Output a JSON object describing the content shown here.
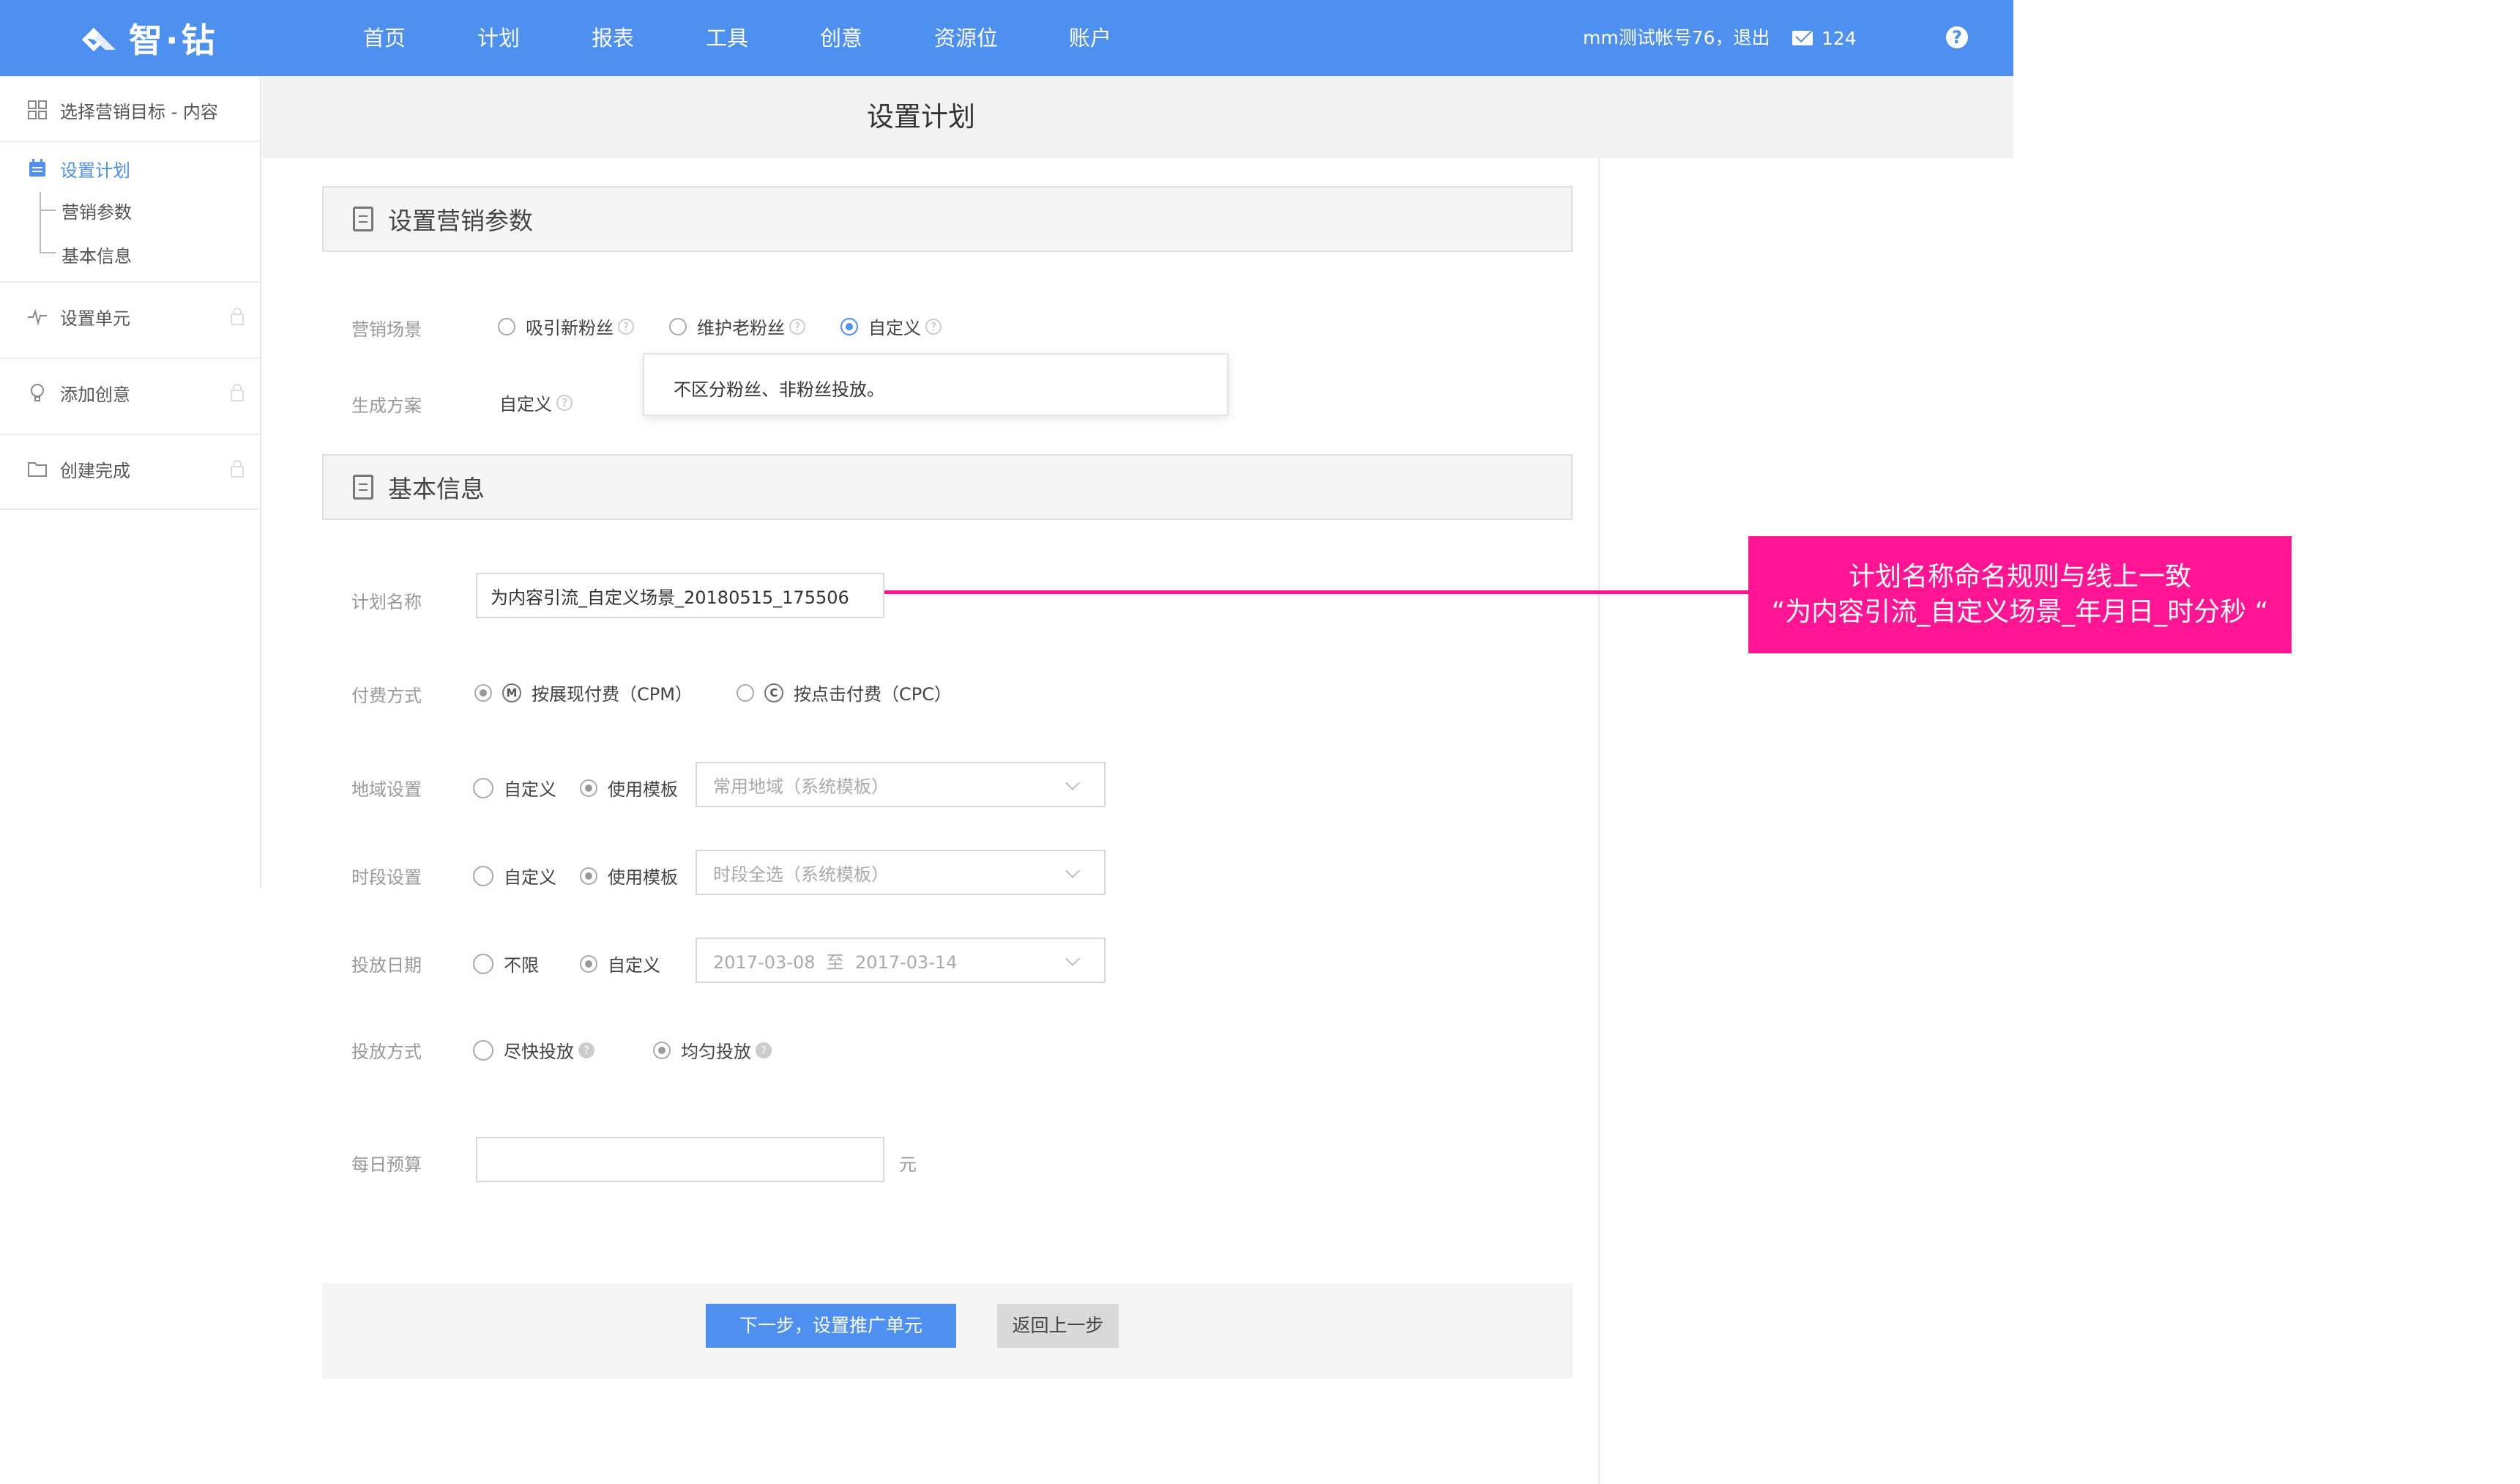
{
  "app": {
    "logo_text": "智·钻"
  },
  "nav": {
    "items": [
      "首页",
      "计划",
      "报表",
      "工具",
      "创意",
      "资源位",
      "账户"
    ],
    "account_text": "mm测试帐号76，退出",
    "message_count": "124",
    "help_icon": "?"
  },
  "sidebar": {
    "step1": "选择营销目标 - 内容",
    "step2": "设置计划",
    "step2_sub1": "营销参数",
    "step2_sub2": "基本信息",
    "step3": "设置单元",
    "step4": "添加创意",
    "step5": "创建完成"
  },
  "page": {
    "title": "设置计划"
  },
  "section1": {
    "title": "设置营销参数",
    "scene_label": "营销场景",
    "scene_options": [
      "吸引新粉丝",
      "维护老粉丝",
      "自定义"
    ],
    "plan_label": "生成方案",
    "plan_value": "自定义",
    "tooltip": "不区分粉丝、非粉丝投放。"
  },
  "section2": {
    "title": "基本信息",
    "name_label": "计划名称",
    "name_value": "为内容引流_自定义场景_20180515_175506",
    "pay_label": "付费方式",
    "pay_cpm_badge": "M",
    "pay_cpm": "按展现付费（CPM）",
    "pay_cpc_badge": "C",
    "pay_cpc": "按点击付费（CPC）",
    "region_label": "地域设置",
    "region_custom": "自定义",
    "region_template": "使用模板",
    "region_select": "常用地域（系统模板）",
    "time_label": "时段设置",
    "time_custom": "自定义",
    "time_template": "使用模板",
    "time_select": "时段全选（系统模板）",
    "date_label": "投放日期",
    "date_unlimited": "不限",
    "date_custom": "自定义",
    "date_range": "2017-03-08  至  2017-03-14",
    "delivery_label": "投放方式",
    "delivery_fast": "尽快投放",
    "delivery_even": "均匀投放",
    "budget_label": "每日预算",
    "budget_value": "",
    "budget_unit": "元"
  },
  "footer": {
    "next_button": "下一步，设置推广单元",
    "back_button": "返回上一步"
  },
  "annotation": {
    "line1": "计划名称命名规则与线上一致",
    "line2": "“为内容引流_自定义场景_年月日_时分秒 “",
    "color": "#ff1493"
  },
  "colors": {
    "brand": "#4d90f0"
  }
}
